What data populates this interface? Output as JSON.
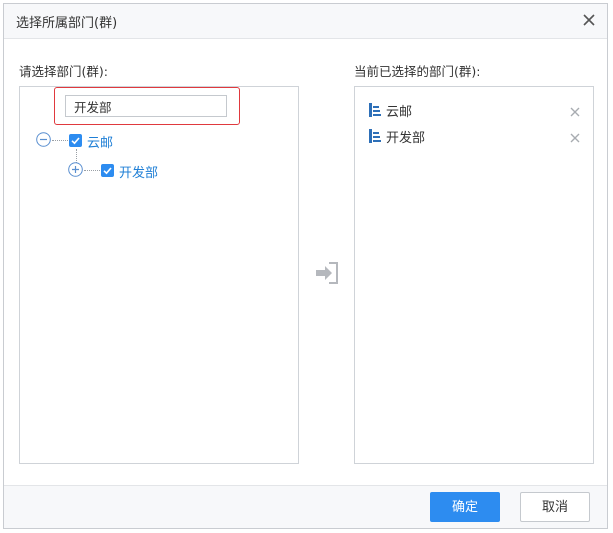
{
  "dialog": {
    "title": "选择所属部门(群)"
  },
  "left_panel": {
    "label": "请选择部门(群):",
    "search": {
      "value": "开发部",
      "placeholder": ""
    },
    "tree": [
      {
        "label": "云邮",
        "checked": true,
        "expanded": true
      },
      {
        "label": "开发部",
        "checked": true,
        "expanded": false
      }
    ]
  },
  "right_panel": {
    "label": "当前已选择的部门(群):",
    "selected": [
      {
        "label": "云邮"
      },
      {
        "label": "开发部"
      }
    ]
  },
  "footer": {
    "confirm_label": "确定",
    "cancel_label": "取消"
  },
  "colors": {
    "accent": "#2d8cf0",
    "highlight_border": "#e0393e",
    "tree_link": "#1f7fd6"
  },
  "icons": {
    "close": "close-icon",
    "move": "arrow-move-right-icon",
    "collapse": "minus-circle-icon",
    "expand": "plus-circle-icon",
    "checkbox": "checkbox-checked-icon",
    "department": "department-tree-icon",
    "remove": "remove-x-icon"
  }
}
